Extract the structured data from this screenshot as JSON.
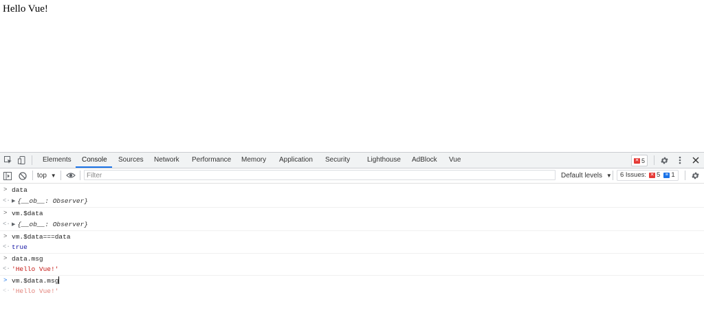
{
  "page": {
    "text": "Hello Vue!"
  },
  "devtools": {
    "tabs": [
      "Elements",
      "Console",
      "Sources",
      "Network",
      "Performance",
      "Memory",
      "Application",
      "Security",
      "Lighthouse",
      "AdBlock",
      "Vue"
    ],
    "active_tab": "Console",
    "error_count": "5",
    "toolbar": {
      "context": "top",
      "filter_placeholder": "Filter",
      "levels_label": "Default levels",
      "issues_label": "6 Issues:",
      "issues_errors": "5",
      "issues_info": "1"
    },
    "console": [
      {
        "type": "input",
        "text": "data"
      },
      {
        "type": "output",
        "text": "{__ob__: Observer}"
      },
      {
        "type": "input",
        "text": "vm.$data"
      },
      {
        "type": "output",
        "text": "{__ob__: Observer}"
      },
      {
        "type": "input",
        "text": "vm.$data===data"
      },
      {
        "type": "output",
        "text": "true"
      },
      {
        "type": "input",
        "text": "data.msg"
      },
      {
        "type": "output",
        "text": "'Hello Vue!'"
      },
      {
        "type": "input",
        "text": "vm.$data.msg"
      },
      {
        "type": "output",
        "text": "'Hello Vue!'"
      }
    ]
  },
  "colors": {
    "accent": "#1a73e8",
    "error": "#e53935",
    "string": "#c41a16"
  },
  "icons": [
    "inspect-icon",
    "device-toggle-icon",
    "more-menu-icon",
    "settings-icon",
    "close-icon",
    "sidebar-toggle-icon",
    "clear-console-icon",
    "eye-icon",
    "dropdown-arrow-icon"
  ]
}
